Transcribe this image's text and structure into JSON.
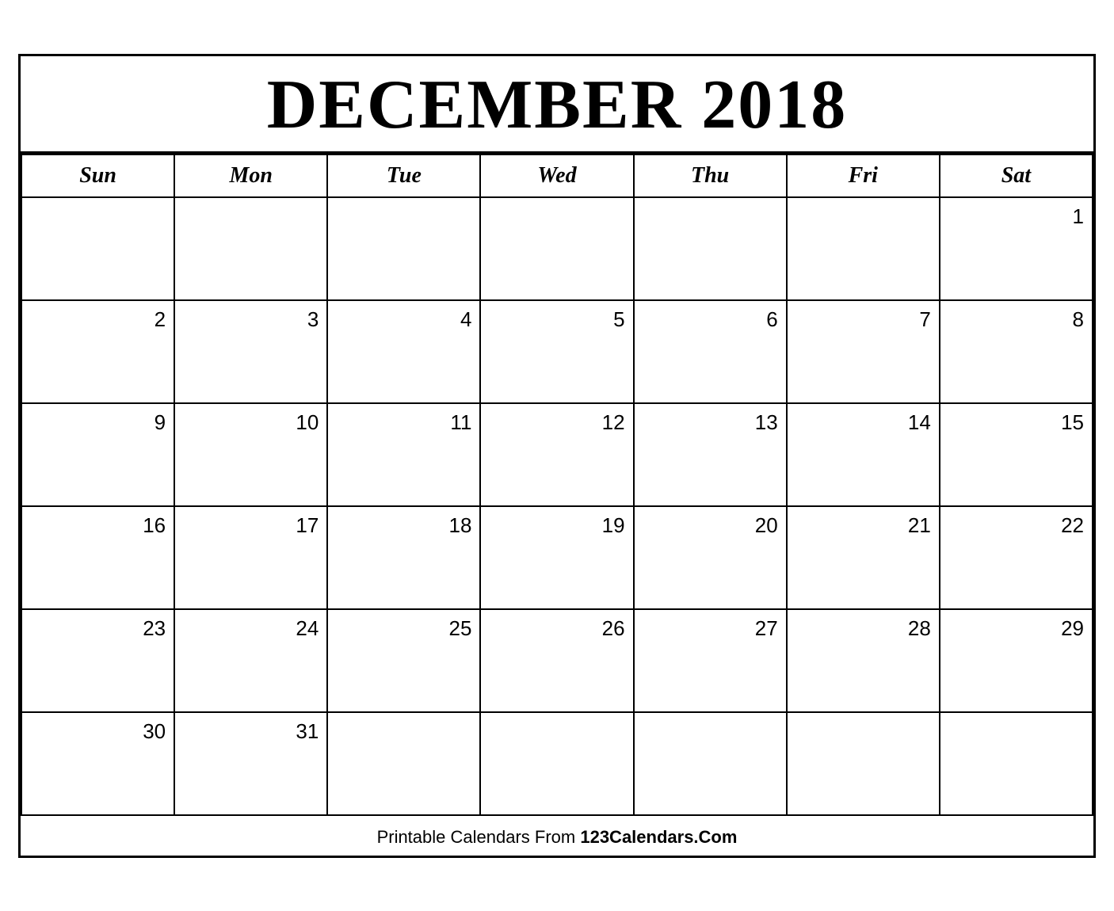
{
  "calendar": {
    "title": "DECEMBER 2018",
    "month": "DECEMBER",
    "year": "2018",
    "days_of_week": [
      "Sun",
      "Mon",
      "Tue",
      "Wed",
      "Thu",
      "Fri",
      "Sat"
    ],
    "weeks": [
      [
        "",
        "",
        "",
        "",
        "",
        "",
        "1"
      ],
      [
        "2",
        "3",
        "4",
        "5",
        "6",
        "7",
        "8"
      ],
      [
        "9",
        "10",
        "11",
        "12",
        "13",
        "14",
        "15"
      ],
      [
        "16",
        "17",
        "18",
        "19",
        "20",
        "21",
        "22"
      ],
      [
        "23",
        "24",
        "25",
        "26",
        "27",
        "28",
        "29"
      ],
      [
        "30",
        "31",
        "",
        "",
        "",
        "",
        ""
      ]
    ]
  },
  "footer": {
    "text_normal": "Printable Calendars From ",
    "text_bold": "123Calendars.Com"
  }
}
